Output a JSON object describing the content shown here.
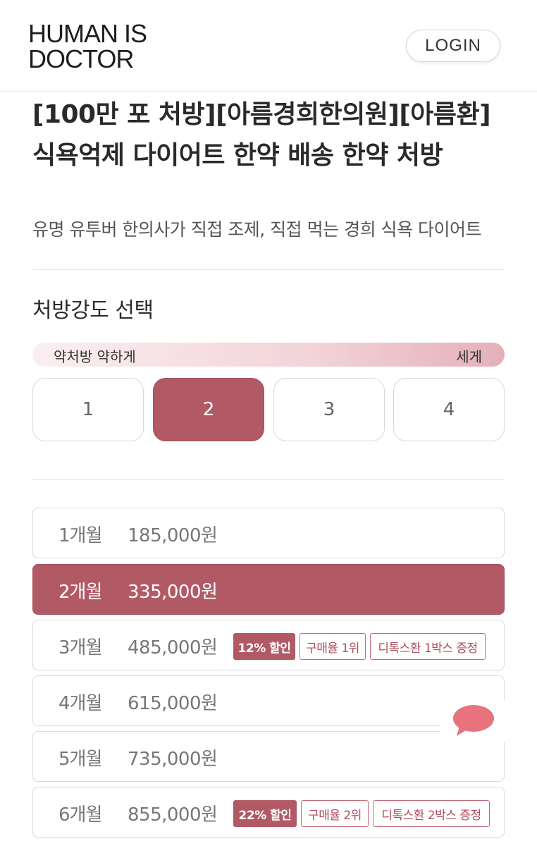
{
  "header": {
    "logo_line1": "HUMAN IS",
    "logo_line2": "DOCTOR",
    "login_label": "LOGIN"
  },
  "product": {
    "title": "[100만 포 처방][아름경희한의원][아름환] 식욕억제 다이어트 한약 배송 한약 처방",
    "subtitle": "유명 유투버 한의사가 직접 조제, 직접 먹는 경희 식욕 다이어트"
  },
  "strength": {
    "section_title": "처방강도 선택",
    "low_label": "약처방 약하게",
    "high_label": "세게",
    "levels": [
      {
        "label": "1",
        "selected": false
      },
      {
        "label": "2",
        "selected": true
      },
      {
        "label": "3",
        "selected": false
      },
      {
        "label": "4",
        "selected": false
      }
    ]
  },
  "plans": [
    {
      "months": "1개월",
      "price": "185,000원",
      "selected": false
    },
    {
      "months": "2개월",
      "price": "335,000원",
      "selected": true
    },
    {
      "months": "3개월",
      "price": "485,000원",
      "selected": false,
      "discount": "12% 할인",
      "rank": "구매율 1위",
      "gift": "디톡스환 1박스 증정"
    },
    {
      "months": "4개월",
      "price": "615,000원",
      "selected": false
    },
    {
      "months": "5개월",
      "price": "735,000원",
      "selected": false
    },
    {
      "months": "6개월",
      "price": "855,000원",
      "selected": false,
      "discount": "22% 할인",
      "rank": "구매율 2위",
      "gift": "디톡스환 2박스 증정"
    }
  ],
  "colors": {
    "accent": "#b15a66",
    "chat_bubble": "#e8737c"
  },
  "icons": {
    "chat": "chat-bubble-icon"
  }
}
